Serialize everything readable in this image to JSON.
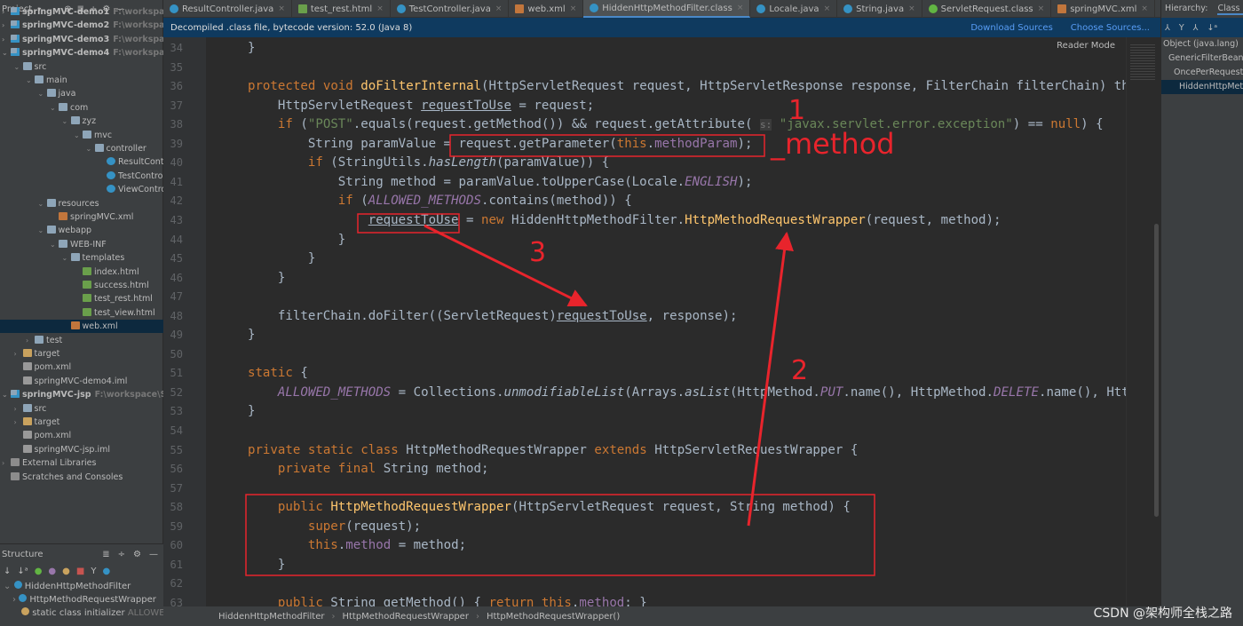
{
  "project_panel": {
    "title": "Project",
    "tree": [
      {
        "level": 0,
        "label": "springMVC-demo1",
        "extra": "F:\\workspace\\S",
        "icon": "module",
        "bold": true,
        "arrow": ">"
      },
      {
        "level": 0,
        "label": "springMVC-demo2",
        "extra": "F:\\workspace\\S",
        "icon": "module",
        "bold": true,
        "arrow": ">"
      },
      {
        "level": 0,
        "label": "springMVC-demo3",
        "extra": "F:\\workspace\\S",
        "icon": "module",
        "bold": true,
        "arrow": ">"
      },
      {
        "level": 0,
        "label": "springMVC-demo4",
        "extra": "F:\\workspace\\S",
        "icon": "module",
        "bold": true,
        "arrow": "v"
      },
      {
        "level": 1,
        "label": "src",
        "icon": "folder",
        "arrow": "v"
      },
      {
        "level": 2,
        "label": "main",
        "icon": "folder",
        "arrow": "v"
      },
      {
        "level": 3,
        "label": "java",
        "icon": "folder",
        "arrow": "v"
      },
      {
        "level": 4,
        "label": "com",
        "icon": "folder",
        "arrow": "v"
      },
      {
        "level": 5,
        "label": "zyz",
        "icon": "folder",
        "arrow": "v"
      },
      {
        "level": 6,
        "label": "mvc",
        "icon": "folder",
        "arrow": "v"
      },
      {
        "level": 7,
        "label": "controller",
        "icon": "folder",
        "arrow": "v"
      },
      {
        "level": 8,
        "label": "ResultCont",
        "icon": "class"
      },
      {
        "level": 8,
        "label": "TestContro",
        "icon": "class"
      },
      {
        "level": 8,
        "label": "ViewContro",
        "icon": "class"
      },
      {
        "level": 3,
        "label": "resources",
        "icon": "folder",
        "arrow": "v"
      },
      {
        "level": 4,
        "label": "springMVC.xml",
        "icon": "xml"
      },
      {
        "level": 3,
        "label": "webapp",
        "icon": "folder",
        "arrow": "v"
      },
      {
        "level": 4,
        "label": "WEB-INF",
        "icon": "folder",
        "arrow": "v"
      },
      {
        "level": 5,
        "label": "templates",
        "icon": "folder",
        "arrow": "v"
      },
      {
        "level": 6,
        "label": "index.html",
        "icon": "html"
      },
      {
        "level": 6,
        "label": "success.html",
        "icon": "html"
      },
      {
        "level": 6,
        "label": "test_rest.html",
        "icon": "html"
      },
      {
        "level": 6,
        "label": "test_view.html",
        "icon": "html"
      },
      {
        "level": 5,
        "label": "web.xml",
        "icon": "xml",
        "selected": true
      },
      {
        "level": 2,
        "label": "test",
        "icon": "folder",
        "arrow": ">"
      },
      {
        "level": 1,
        "label": "target",
        "icon": "target",
        "arrow": ">"
      },
      {
        "level": 1,
        "label": "pom.xml",
        "icon": "file"
      },
      {
        "level": 1,
        "label": "springMVC-demo4.iml",
        "icon": "file"
      },
      {
        "level": 0,
        "label": "springMVC-jsp",
        "extra": "F:\\workspace\\Spri",
        "icon": "module",
        "bold": true,
        "arrow": "v"
      },
      {
        "level": 1,
        "label": "src",
        "icon": "folder",
        "arrow": ">"
      },
      {
        "level": 1,
        "label": "target",
        "icon": "target",
        "arrow": ">"
      },
      {
        "level": 1,
        "label": "pom.xml",
        "icon": "file"
      },
      {
        "level": 1,
        "label": "springMVC-jsp.iml",
        "icon": "file"
      },
      {
        "level": 0,
        "label": "External Libraries",
        "icon": "lib",
        "arrow": ">"
      },
      {
        "level": 0,
        "label": "Scratches and Consoles",
        "icon": "lib"
      }
    ]
  },
  "structure_panel": {
    "title": "Structure",
    "items": [
      {
        "label": "HiddenHttpMethodFilter",
        "extra": ""
      },
      {
        "label": "HttpMethodRequestWrapper",
        "extra": ""
      },
      {
        "label": "static class initializer",
        "extra": "ALLOWED_I"
      }
    ]
  },
  "tabs": [
    {
      "label": "ResultController.java",
      "icon": "class"
    },
    {
      "label": "test_rest.html",
      "icon": "html"
    },
    {
      "label": "TestController.java",
      "icon": "class"
    },
    {
      "label": "web.xml",
      "icon": "xml"
    },
    {
      "label": "HiddenHttpMethodFilter.class",
      "icon": "class",
      "active": true
    },
    {
      "label": "Locale.java",
      "icon": "class"
    },
    {
      "label": "String.java",
      "icon": "class"
    },
    {
      "label": "ServletRequest.class",
      "icon": "interface"
    },
    {
      "label": "springMVC.xml",
      "icon": "xml"
    },
    {
      "label": "test_view.html",
      "icon": "html"
    }
  ],
  "infobar": {
    "message": "Decompiled .class file, bytecode version: 52.0 (Java 8)",
    "download_sources": "Download Sources",
    "choose_sources": "Choose Sources..."
  },
  "editor": {
    "reader_mode": "Reader Mode",
    "first_line": 34,
    "lines": [
      "    }",
      "",
      "    protected void doFilterInternal(HttpServletRequest request, HttpServletResponse response, FilterChain filterChain) th",
      "        HttpServletRequest requestToUse = request;",
      "        if (\"POST\".equals(request.getMethod()) && request.getAttribute( s: \"javax.servlet.error.exception\") == null) {",
      "            String paramValue = request.getParameter(this.methodParam);",
      "            if (StringUtils.hasLength(paramValue)) {",
      "                String method = paramValue.toUpperCase(Locale.ENGLISH);",
      "                if (ALLOWED_METHODS.contains(method)) {",
      "                    requestToUse = new HiddenHttpMethodFilter.HttpMethodRequestWrapper(request, method);",
      "                }",
      "            }",
      "        }",
      "",
      "        filterChain.doFilter((ServletRequest)requestToUse, response);",
      "    }",
      "",
      "    static {",
      "        ALLOWED_METHODS = Collections.unmodifiableList(Arrays.asList(HttpMethod.PUT.name(), HttpMethod.DELETE.name(), Htt",
      "    }",
      "",
      "    private static class HttpMethodRequestWrapper extends HttpServletRequestWrapper {",
      "        private final String method;",
      "",
      "        public HttpMethodRequestWrapper(HttpServletRequest request, String method) {",
      "            super(request);",
      "            this.method = method;",
      "        }",
      "",
      "        public String getMethod() { return this.method; }"
    ]
  },
  "breadcrumb": [
    "HiddenHttpMethodFilter",
    "HttpMethodRequestWrapper",
    "HttpMethodRequestWrapper()"
  ],
  "hierarchy": {
    "label": "Hierarchy:",
    "tab": "Class H",
    "items": [
      "Object (java.lang)",
      "GenericFilterBean",
      "OncePerRequestFilter",
      "HiddenHttpMethodFilter"
    ]
  },
  "annotations": {
    "color": "#e8242c",
    "label_1": "1",
    "label_method": "_method",
    "label_2": "2",
    "label_3": "3"
  },
  "watermark": "CSDN @架构师全栈之路"
}
